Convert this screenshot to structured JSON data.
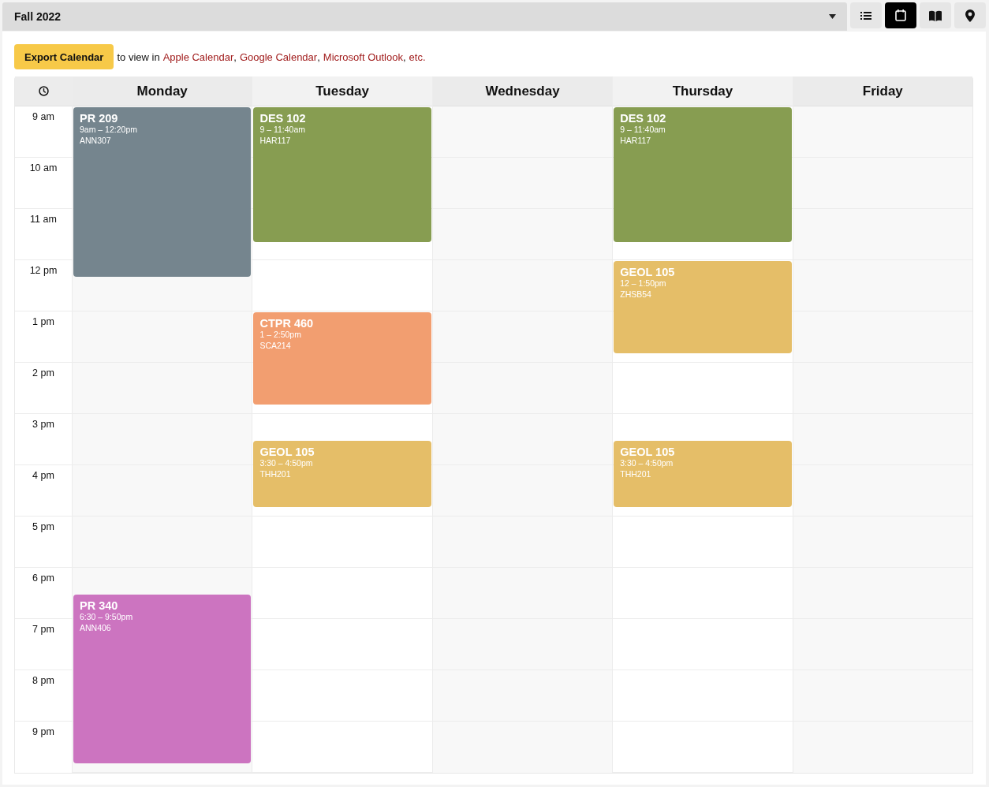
{
  "term_select": {
    "value": "Fall 2022"
  },
  "view_buttons": [
    {
      "kind": "list",
      "selected": false
    },
    {
      "kind": "calendar",
      "selected": true
    },
    {
      "kind": "book",
      "selected": false
    },
    {
      "kind": "pin",
      "selected": false
    }
  ],
  "export": {
    "button": "Export Calendar",
    "parts": [
      {
        "kind": "text",
        "text": "to view in"
      },
      {
        "kind": "link",
        "text": "Apple Calendar"
      },
      {
        "kind": "comma",
        "text": ","
      },
      {
        "kind": "link",
        "text": "Google Calendar"
      },
      {
        "kind": "comma",
        "text": ","
      },
      {
        "kind": "link",
        "text": "Microsoft Outlook"
      },
      {
        "kind": "comma",
        "text": ","
      },
      {
        "kind": "link",
        "text": "etc."
      }
    ]
  },
  "hours": [
    "9 am",
    "10 am",
    "11 am",
    "12 pm",
    "1 pm",
    "2 pm",
    "3 pm",
    "4 pm",
    "5 pm",
    "6 pm",
    "7 pm",
    "8 pm",
    "9 pm"
  ],
  "days": [
    {
      "name": "Monday",
      "events": [
        {
          "title": "PR 209",
          "time": "9am – 12:20pm",
          "room": "ANN307",
          "color": "#75858e"
        },
        {
          "title": "PR 340",
          "time": "6:30 – 9:50pm",
          "room": "ANN406",
          "color": "#cc74c0"
        }
      ]
    },
    {
      "name": "Tuesday",
      "events": [
        {
          "title": "DES 102",
          "time": "9 – 11:40am",
          "room": "HAR117",
          "color": "#879d51"
        },
        {
          "title": "CTPR 460",
          "time": "1 – 2:50pm",
          "room": "SCA214",
          "color": "#f29e70"
        },
        {
          "title": "GEOL 105",
          "time": "3:30 – 4:50pm",
          "room": "THH201",
          "color": "#e5be68"
        }
      ]
    },
    {
      "name": "Wednesday"
    },
    {
      "name": "Thursday",
      "events": [
        {
          "title": "DES 102",
          "time": "9 – 11:40am",
          "room": "HAR117",
          "color": "#879d51"
        },
        {
          "title": "GEOL 105",
          "time": "12 – 1:50pm",
          "room": "ZHSB54",
          "color": "#e5be68"
        },
        {
          "title": "GEOL 105",
          "time": "3:30 – 4:50pm",
          "room": "THH201",
          "color": "#e5be68"
        }
      ]
    },
    {
      "name": "Friday"
    }
  ]
}
